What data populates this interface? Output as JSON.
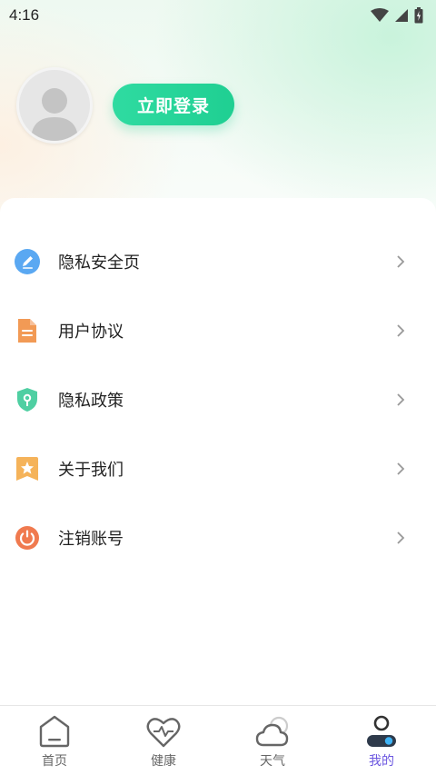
{
  "status_bar": {
    "time": "4:16"
  },
  "profile": {
    "login_label": "立即登录"
  },
  "menu": [
    {
      "label": "隐私安全页",
      "icon": "edit-icon",
      "color": "#5aa8f2"
    },
    {
      "label": "用户协议",
      "icon": "document-icon",
      "color": "#f29a55"
    },
    {
      "label": "隐私政策",
      "icon": "shield-icon",
      "color": "#4fcfa2"
    },
    {
      "label": "关于我们",
      "icon": "star-badge-icon",
      "color": "#f5b35a"
    },
    {
      "label": "注销账号",
      "icon": "power-icon",
      "color": "#f07a4f"
    }
  ],
  "bottom_nav": [
    {
      "label": "首页",
      "icon": "home-icon"
    },
    {
      "label": "健康",
      "icon": "heart-pulse-icon"
    },
    {
      "label": "天气",
      "icon": "cloud-icon"
    },
    {
      "label": "我的",
      "icon": "profile-icon",
      "active": true
    }
  ],
  "colors": {
    "accent": "#1fcf92",
    "nav_active": "#6b56e0"
  }
}
